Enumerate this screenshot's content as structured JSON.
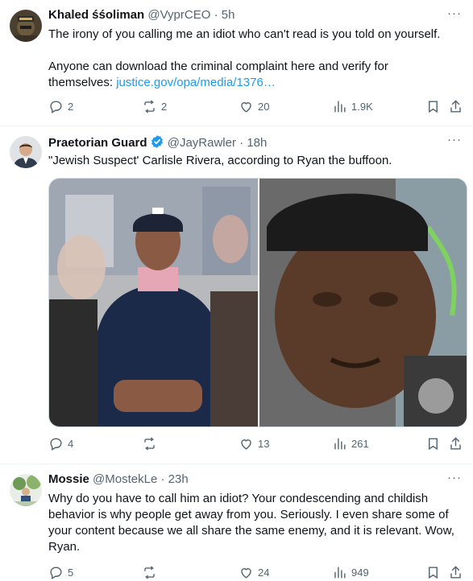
{
  "tweets": [
    {
      "name": "Khaled śśoliman",
      "handle": "@VyprCEO",
      "time": "5h",
      "text_line1": "The irony of you calling me an idiot who can't read is you told on yourself.",
      "text_line2": "Anyone can download the criminal complaint here and verify for",
      "text_line3_prefix": "themselves: ",
      "link": "justice.gov/opa/media/1376…",
      "replies": "2",
      "reposts": "2",
      "likes": "20",
      "views": "1.9K"
    },
    {
      "name": "Praetorian Guard",
      "handle": "@JayRawler",
      "time": "18h",
      "text": "\"Jewish Suspect' Carlisle Rivera, according to Ryan the buffoon.",
      "replies": "4",
      "reposts": "",
      "likes": "13",
      "views": "261",
      "verified_color": "#1d9bf0"
    },
    {
      "name": "Mossie",
      "handle": "@MostekLe",
      "time": "23h",
      "lines": [
        "Why do you have to call him an idiot?  Your condescending and childish",
        "behavior is why people get away from you. Seriously. I even share some of",
        "your content because we all share the same enemy, and it is relevant. Wow,",
        "Ryan."
      ],
      "replies": "5",
      "reposts": "",
      "likes": "24",
      "views": "949"
    }
  ],
  "ui": {
    "more_glyph": "···",
    "dot": " · "
  },
  "colors": {
    "meta": "#536471",
    "link": "#1d9bf0",
    "divider": "#eff3f4"
  }
}
